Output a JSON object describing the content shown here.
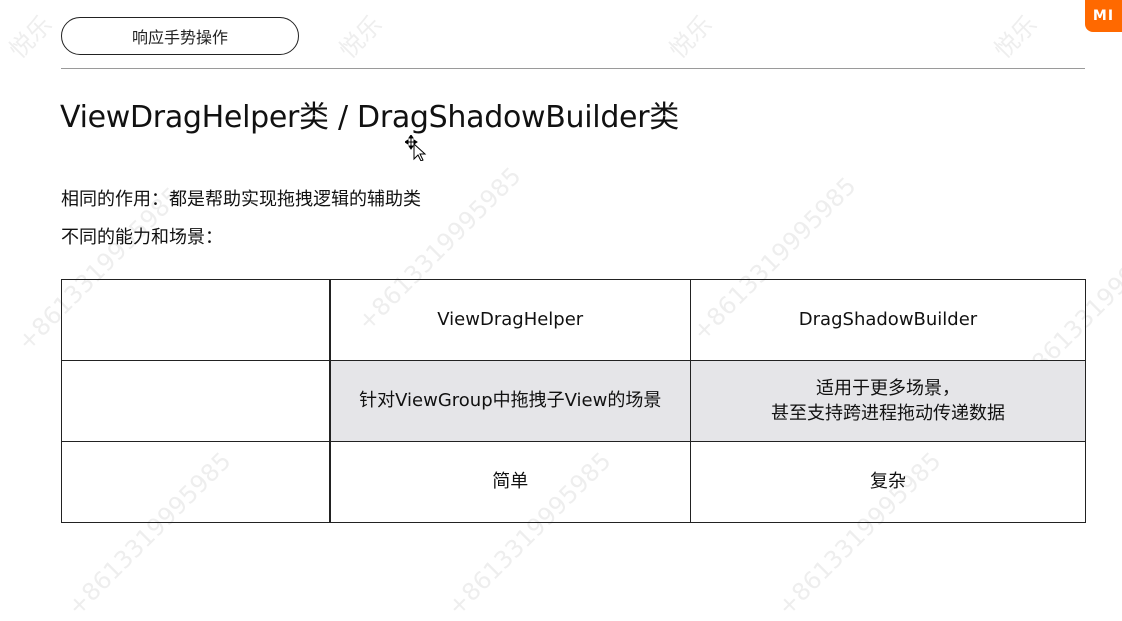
{
  "header": {
    "pill_label": "响应手势操作",
    "logo_text": "MI",
    "brand_color": "#ff6900"
  },
  "title": "ViewDragHelper类 / DragShadowBuilder类",
  "body": {
    "line1": "相同的作用：都是帮助实现拖拽逻辑的辅助类",
    "line2": "不同的能力和场景："
  },
  "table": {
    "headers": [
      "",
      "ViewDragHelper",
      "DragShadowBuilder"
    ],
    "rows": [
      {
        "label": "",
        "col1": "针对ViewGroup中拖拽子View的场景",
        "col2_line1": "适用于更多场景，",
        "col2_line2": "甚至支持跨进程拖动传递数据"
      },
      {
        "label": "",
        "col1": "简单",
        "col2": "复杂"
      }
    ]
  },
  "watermark": {
    "name": "悦乐",
    "phone": "+8613319995985"
  }
}
